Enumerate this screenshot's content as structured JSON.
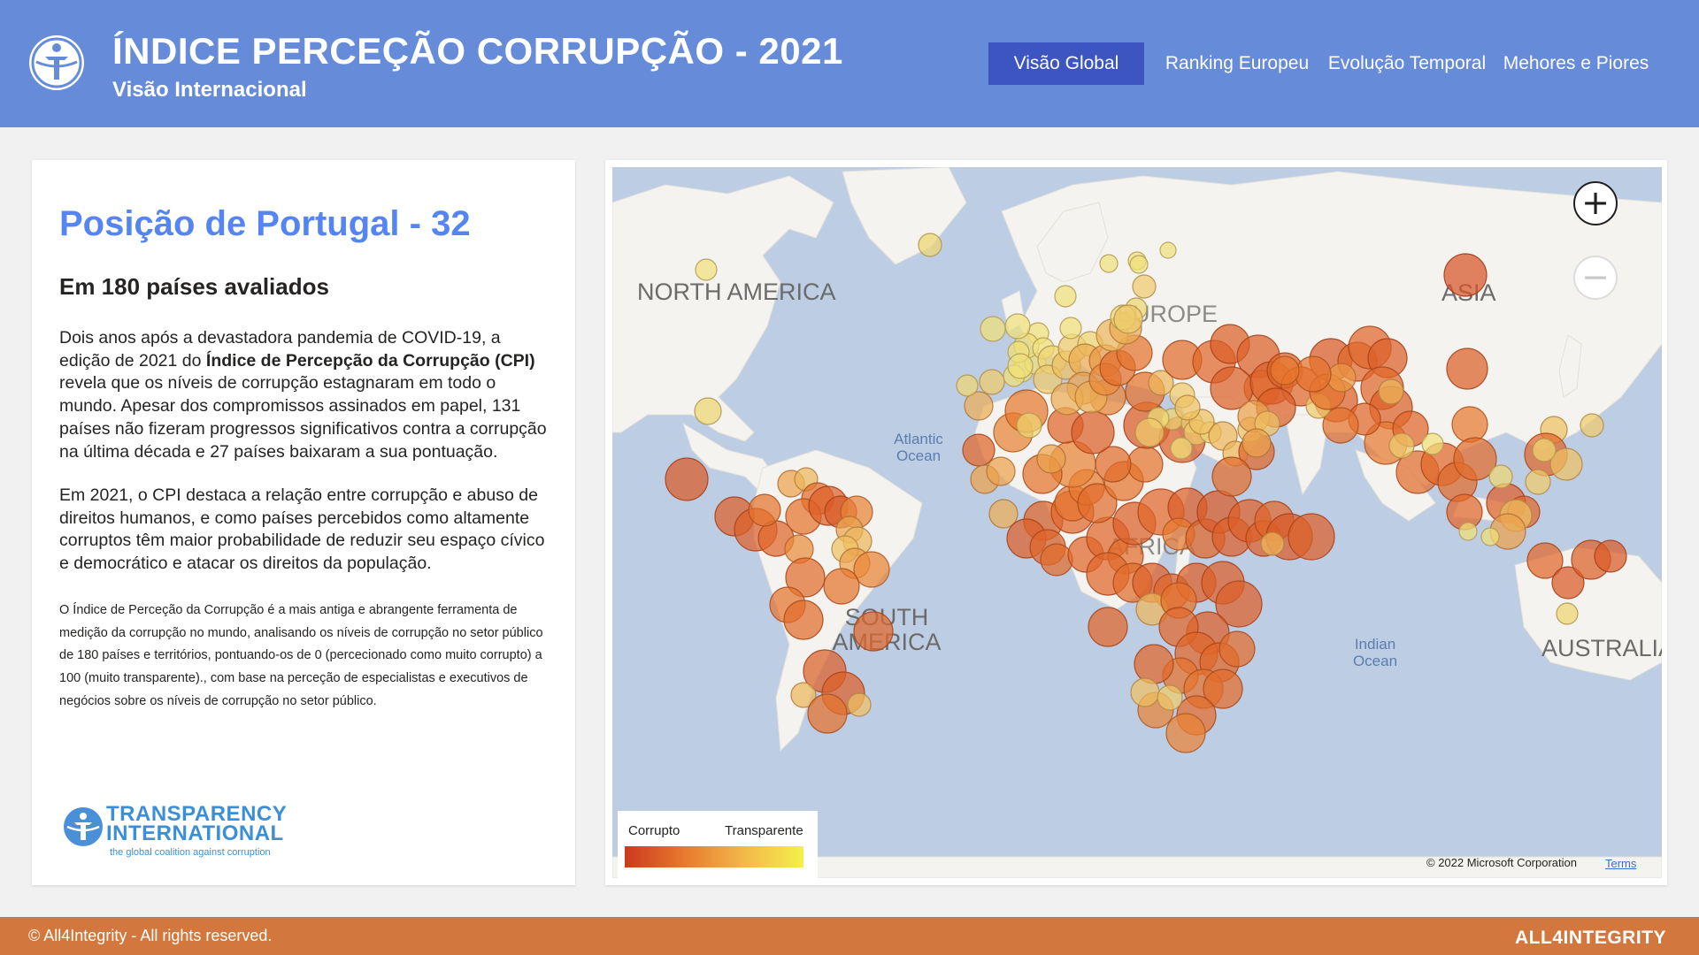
{
  "header": {
    "title": "ÍNDICE PERCEÇÃO CORRUPÇÃO - 2021",
    "subtitle": "Visão Internacional",
    "logo_icon": "transparency-globe-icon",
    "nav": [
      {
        "label": "Visão Global",
        "active": true
      },
      {
        "label": "Ranking Europeu",
        "active": false
      },
      {
        "label": "Evolução Temporal",
        "active": false
      },
      {
        "label": "Mehores e Piores",
        "active": false
      }
    ]
  },
  "summary": {
    "heading": "Posição de Portugal - 32",
    "subheading": "Em 180 países avaliados",
    "para1_before": "Dois anos após a devastadora pandemia de COVID-19, a edição de 2021 do ",
    "para1_bold": "Índice de Percepção da Corrupção (CPI)",
    "para1_after": " revela que os níveis de corrupção estagnaram em todo o mundo. Apesar dos compromissos assinados em papel, 131 países não fizeram progressos significativos contra a corrupção na última década e 27 países baixaram a sua pontuação.",
    "para2": "Em 2021, o CPI destaca a relação entre corrupção e abuso de direitos humanos, e como países percebidos como altamente corruptos têm maior probabilidade de reduzir seu espaço cívico e democrático e atacar os direitos da população.",
    "para3": "O Índice de Perceção da Corrupção é a mais antiga e abrangente ferramenta de medição da corrupção no mundo, analisando os níveis de corrupção no setor público de 180 países e territórios, pontuando-os  de 0 (percecionado como muito corrupto) a 100 (muito transparente)., com base na perceção de especialistas e executivos de negócios sobre os níveis de corrupção no setor público.",
    "ti_logo": {
      "line1": "TRANSPARENCY",
      "line2": "INTERNATIONAL",
      "tagline": "the global coalition against corruption",
      "color": "#3b8fd8"
    }
  },
  "map": {
    "regions": [
      "NORTH AMERICA",
      "EUROPE",
      "ASIA",
      "AFRICA",
      "SOUTH AMERICA",
      "AUSTRALIA"
    ],
    "oceans": [
      "Atlantic Ocean",
      "Indian Ocean"
    ],
    "zoom_in_icon": "plus-icon",
    "zoom_out_icon": "minus-icon",
    "legend": {
      "low_label": "Corrupto",
      "high_label": "Transparente",
      "colors": [
        "#cc3a1f",
        "#e8792e",
        "#f2b84b",
        "#f5f04a"
      ]
    },
    "copyright": "© 2022 Microsoft Corporation",
    "terms": "Terms",
    "bubble_fill_low": "#d9552c",
    "bubble_fill_high": "#f0e07a"
  },
  "footer": {
    "copyright": "© All4Integrity - All rights reserved.",
    "brand": "ALL4INTEGRITY"
  },
  "colors": {
    "header_bg": "#658bd9",
    "nav_active_bg": "#3d55c0",
    "accent_blue": "#5585f2",
    "footer_bg": "#d2783e"
  }
}
